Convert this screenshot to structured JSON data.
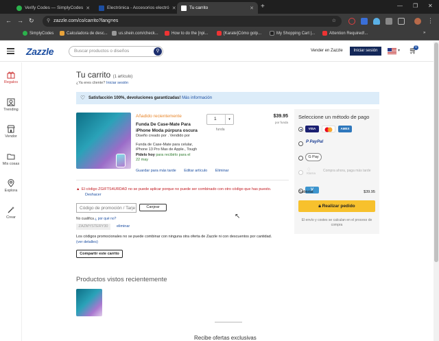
{
  "browser": {
    "tabs": [
      {
        "title": "Verify Codes — SimplyCodes",
        "active": false
      },
      {
        "title": "Electrónica - Accesorios electró",
        "active": false
      },
      {
        "title": "Tu carrito",
        "active": true
      }
    ],
    "url": "zazzle.com/co/carrito?lang=es",
    "bookmarks": [
      "SimplyCodes",
      "Calculadora de desc...",
      "us.shein.com/check...",
      "How to do the [npi...",
      "[Karate]Cómo golp...",
      "My Shopping Cart |...",
      "Attention Required!..."
    ]
  },
  "header": {
    "logo": "Zazzle",
    "search_placeholder": "Buscar productos o diseños",
    "sell_label": "Vender en Zazzle",
    "signin_label": "Iniciar sesión",
    "cart_count": "0"
  },
  "sidenav": [
    {
      "label": "Regalos",
      "icon": "gift-icon",
      "active": true
    },
    {
      "label": "Trending",
      "icon": "trending-icon",
      "active": false
    },
    {
      "label": "Vendor",
      "icon": "store-icon",
      "active": false
    },
    {
      "label": "Mis cosas",
      "icon": "folder-icon",
      "active": false
    },
    {
      "label": "Explora",
      "icon": "location-pin-icon",
      "active": false
    },
    {
      "label": "Crear",
      "icon": "magic-wand-icon",
      "active": false
    }
  ],
  "cart": {
    "title": "Tu carrito",
    "count": "(1 artículo)",
    "already_customer": "¿Ya eres cliente?",
    "signin_link": "Iniciar sesión",
    "banner_text": "Satisfacción 100%, devoluciones garantizadas!",
    "banner_link": "Más información",
    "item": {
      "badge": "Añadido recientemente",
      "name": "Funda De Case-Mate Para iPhone Moda púrpura oscura",
      "created_by": "Diseño creado por . Vendido por",
      "description": "Funda de Case-Mate para celular, iPhone 13 Pro Max de Apple., Tough",
      "delivery_prefix": "Pídelo hoy",
      "delivery_text": "para recibirlo para el 22 may",
      "quantity": "1",
      "quantity_label": "funda",
      "price": "$39.95",
      "price_unit": "por funda",
      "actions": [
        "Guardar para más tarde",
        "Editar artículo",
        "Eliminar"
      ]
    },
    "promo": {
      "error": "El código ZGIFTS4URDAD no se puede aplicar porque no puede ser combinado con otro código que has puesto.",
      "undo": "Deshacer",
      "placeholder": "Código de promoción / Tarje",
      "apply_label": "Canjear",
      "no_qualify": "No cualifica",
      "why_link": "¿ por qué no?",
      "applied_code": "ZAZMYSTERY30",
      "remove_label": "eliminar",
      "note": "Los códigos promocionales no se puede combinar con ninguna otra oferta de Zazzle ni con descuentos por cantidad.",
      "details_link": "(ver detalles)"
    },
    "share_label": "Compartir este carrito",
    "recently_viewed_title": "Productos vistos recientemente",
    "offers_title": "Recibe ofertas exclusivas"
  },
  "payment": {
    "title": "Seleccione un método de pago",
    "methods": {
      "cards": [
        "VISA",
        "Mastercard",
        "AMEX"
      ],
      "paypal": "PayPal",
      "gpay": "G Pay",
      "klarna_logo": "Klarna",
      "klarna": "Compra ahora, paga más tarde",
      "venmo": "V"
    },
    "subtotal_label": "Subtotal:",
    "subtotal_value": "$39.95",
    "checkout_label": "Realizar pedido",
    "ship_note": "El envío y costes se calculan en el proceso de compra"
  },
  "colors": {
    "brand": "#1c4ea1",
    "checkout": "#f7c12d",
    "error": "#c0161d",
    "banner": "#dcecf9"
  }
}
